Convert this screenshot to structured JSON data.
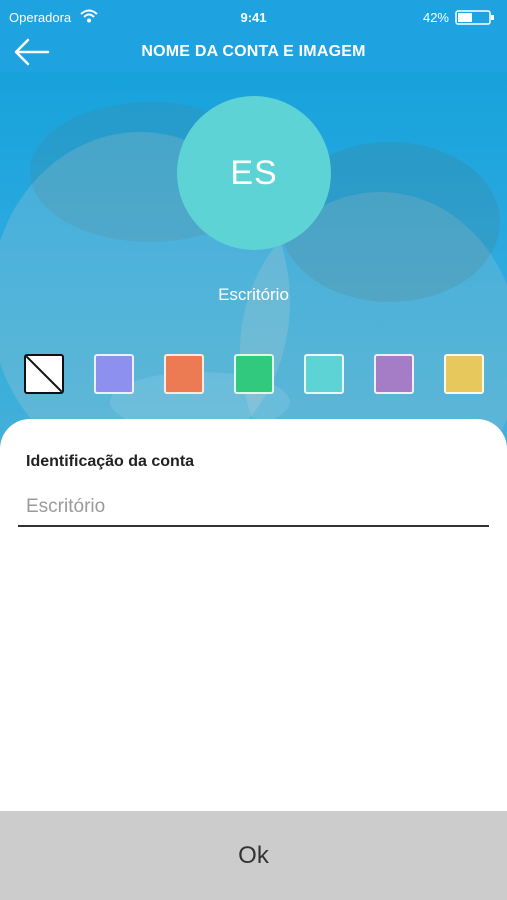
{
  "status_bar": {
    "carrier": "Operadora",
    "time": "9:41",
    "battery_percent": "42%"
  },
  "nav": {
    "title": "NOME DA CONTA E IMAGEM",
    "back_icon": "arrow-left-icon"
  },
  "avatar": {
    "initials": "ES",
    "name": "Escritório",
    "color": "#5ed3d6"
  },
  "swatches": [
    {
      "name": "none",
      "color": "#ffffff"
    },
    {
      "name": "blue-violet",
      "color": "#8e90f0"
    },
    {
      "name": "orange",
      "color": "#ec7a52"
    },
    {
      "name": "green",
      "color": "#31c97d"
    },
    {
      "name": "cyan",
      "color": "#5ed3d6"
    },
    {
      "name": "purple",
      "color": "#a57dc7"
    },
    {
      "name": "yellow",
      "color": "#e6c85d"
    }
  ],
  "form": {
    "label": "Identificação da conta",
    "placeholder": "Escritório",
    "value": ""
  },
  "ok_button": {
    "label": "Ok"
  },
  "colors": {
    "primary": "#1ea3e0",
    "button_bg": "#cccccc"
  }
}
